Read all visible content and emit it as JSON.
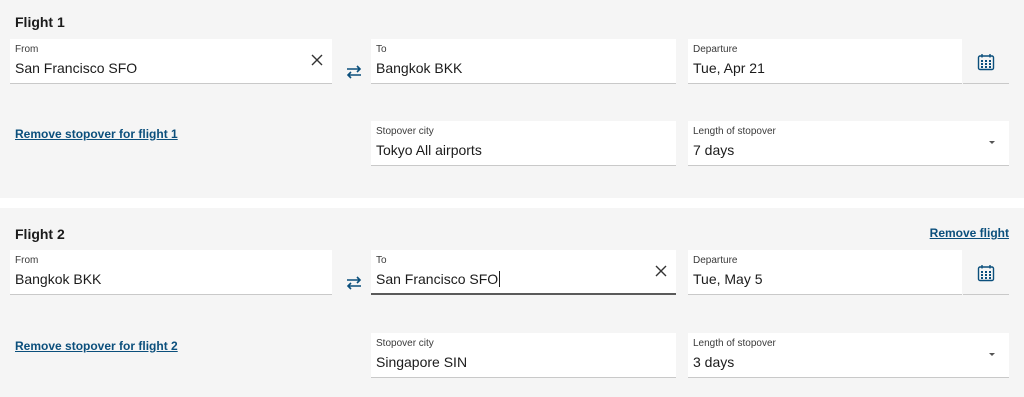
{
  "flight1": {
    "title": "Flight 1",
    "from": {
      "label": "From",
      "value": "San Francisco SFO"
    },
    "to": {
      "label": "To",
      "value": "Bangkok BKK"
    },
    "departure": {
      "label": "Departure",
      "value": "Tue, Apr 21"
    },
    "remove_stopover": "Remove stopover for flight 1",
    "stopover_city": {
      "label": "Stopover city",
      "value": "Tokyo All airports"
    },
    "stopover_length": {
      "label": "Length of stopover",
      "value": "7 days"
    }
  },
  "flight2": {
    "title": "Flight 2",
    "remove_flight": "Remove flight",
    "from": {
      "label": "From",
      "value": "Bangkok BKK"
    },
    "to": {
      "label": "To",
      "value": "San Francisco SFO"
    },
    "departure": {
      "label": "Departure",
      "value": "Tue, May 5"
    },
    "remove_stopover": "Remove stopover for flight 2",
    "stopover_city": {
      "label": "Stopover city",
      "value": "Singapore SIN"
    },
    "stopover_length": {
      "label": "Length of stopover",
      "value": "3 days"
    }
  },
  "icons": {
    "clear": "close-icon",
    "swap": "swap-arrows-icon",
    "calendar": "calendar-icon",
    "dropdown": "chevron-down-icon"
  },
  "colors": {
    "link": "#0b4f7c",
    "section_bg": "#f5f5f5",
    "swap_icon": "#0b4f7c",
    "calendar_icon": "#0b4f7c"
  }
}
